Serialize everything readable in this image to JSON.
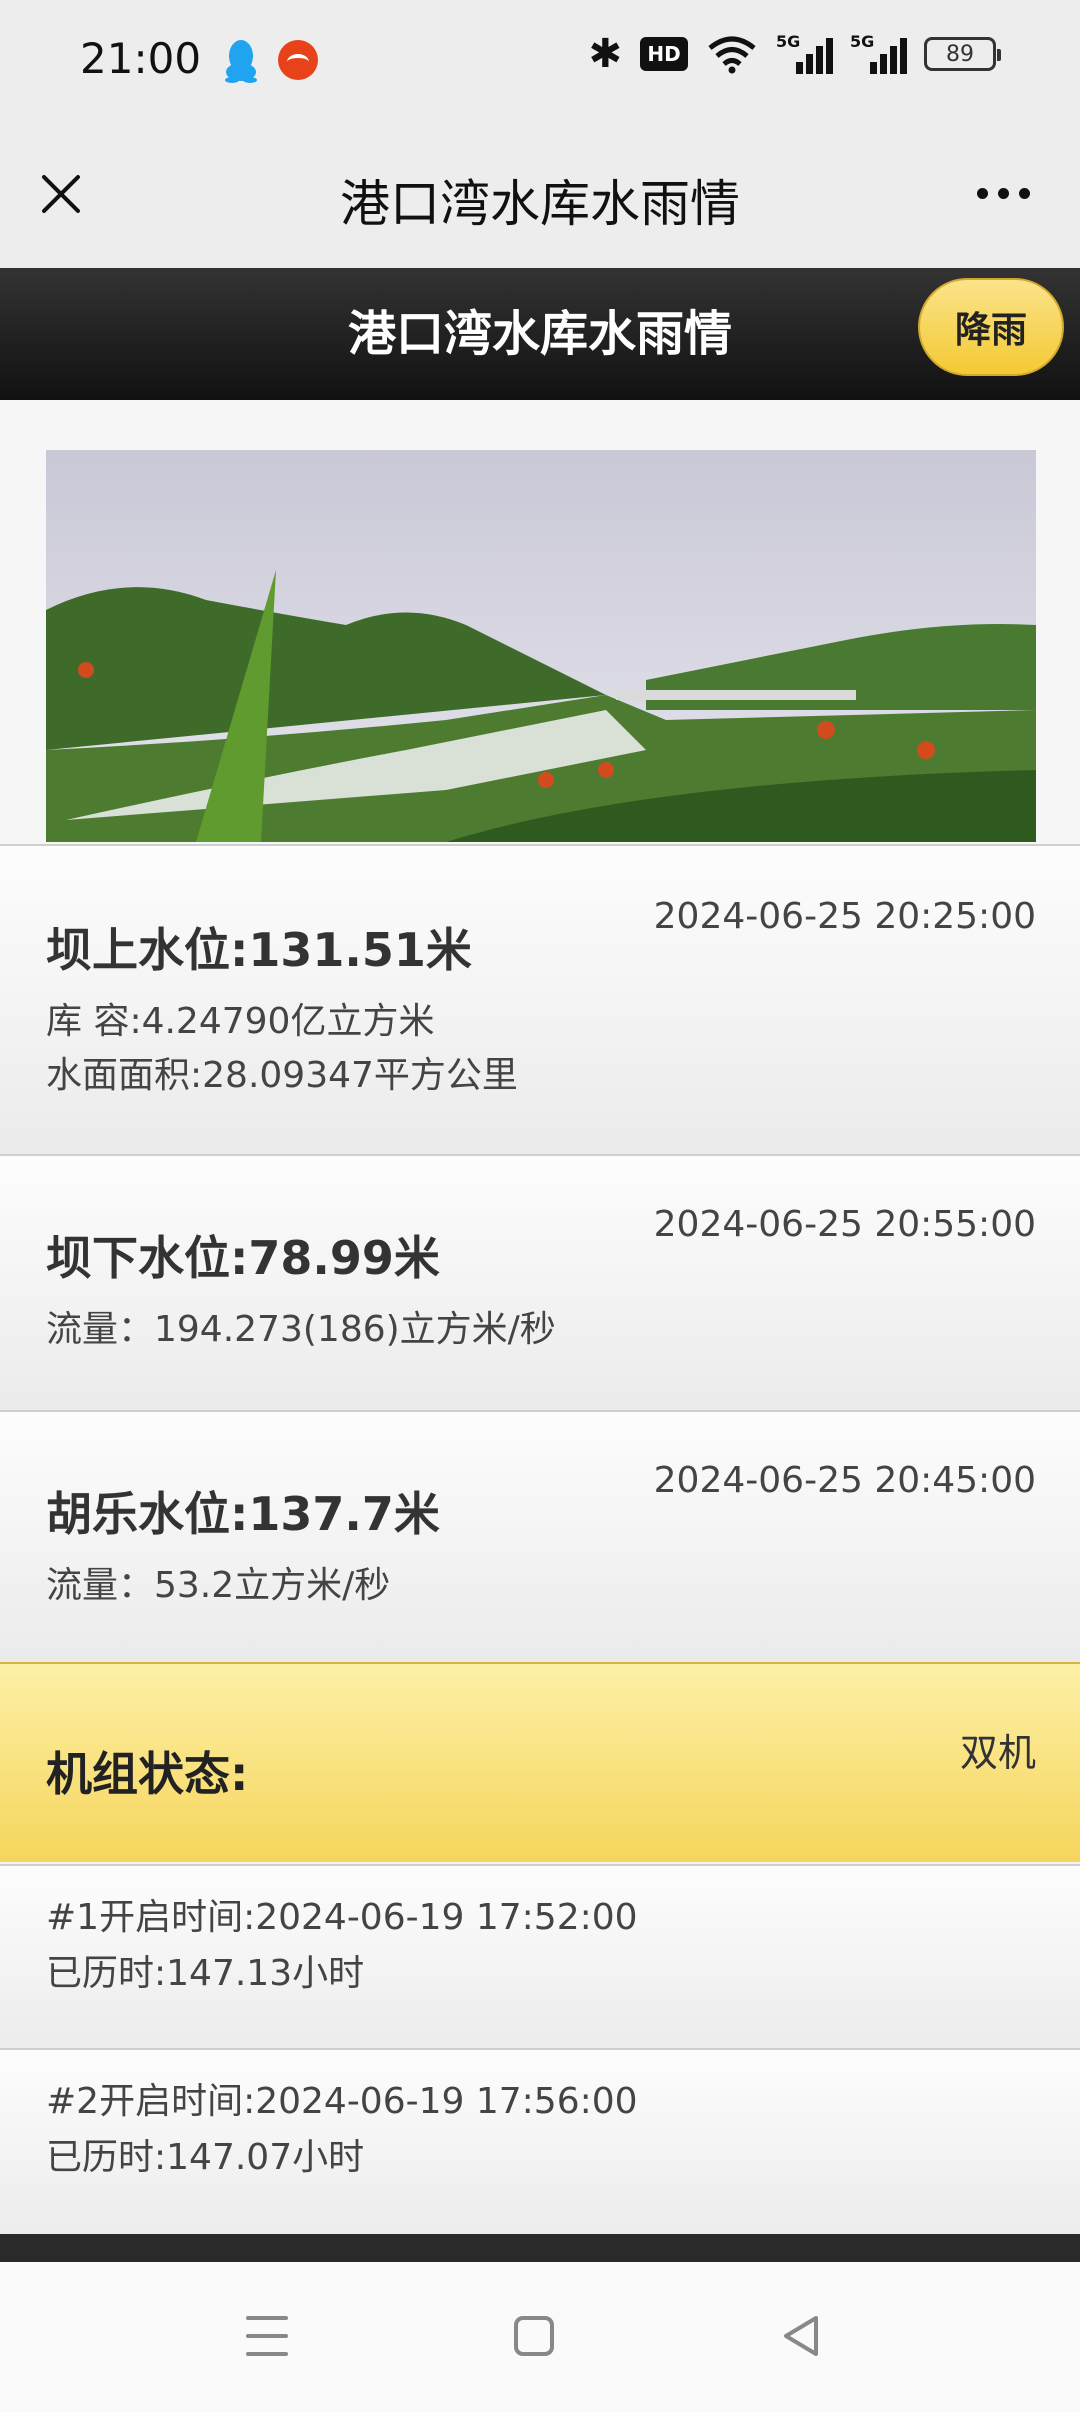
{
  "status_bar": {
    "time": "21:00",
    "hd_label": "HD",
    "signal1_label": "5G",
    "signal2_label": "5G",
    "battery": "89"
  },
  "title_bar": {
    "title": "港口湾水库水雨情"
  },
  "header": {
    "title": "港口湾水库水雨情",
    "rain_button": "降雨"
  },
  "cards": [
    {
      "title": "坝上水位:131.51米",
      "time": "2024-06-25 20:25:00",
      "lines": [
        "库 容:4.24790亿立方米",
        "水面面积:28.09347平方公里"
      ]
    },
    {
      "title": "坝下水位:78.99米",
      "time": "2024-06-25 20:55:00",
      "lines": [
        "流量：194.273(186)立方米/秒"
      ]
    },
    {
      "title": "胡乐水位:137.7米",
      "time": "2024-06-25 20:45:00",
      "lines": [
        "流量：53.2立方米/秒"
      ]
    }
  ],
  "unit_status": {
    "label": "机组状态:",
    "value": "双机",
    "units": [
      {
        "start": "#1开启时间:2024-06-19 17:52:00",
        "elapsed": "已历时:147.13小时"
      },
      {
        "start": "#2开启时间:2024-06-19 17:56:00",
        "elapsed": "已历时:147.07小时"
      }
    ]
  },
  "icons": {
    "qq": "qq-penguin-icon",
    "app": "app-badge-icon",
    "bluetooth": "bluetooth-icon",
    "wifi": "wifi-icon",
    "close": "close-icon",
    "more": "more-icon",
    "nav_menu": "menu-icon",
    "nav_home": "home-icon",
    "nav_back": "back-icon"
  },
  "colors": {
    "header_bg": "#1a1a1a",
    "accent_yellow": "#f5d55c",
    "rain_button": "#f3c934"
  }
}
